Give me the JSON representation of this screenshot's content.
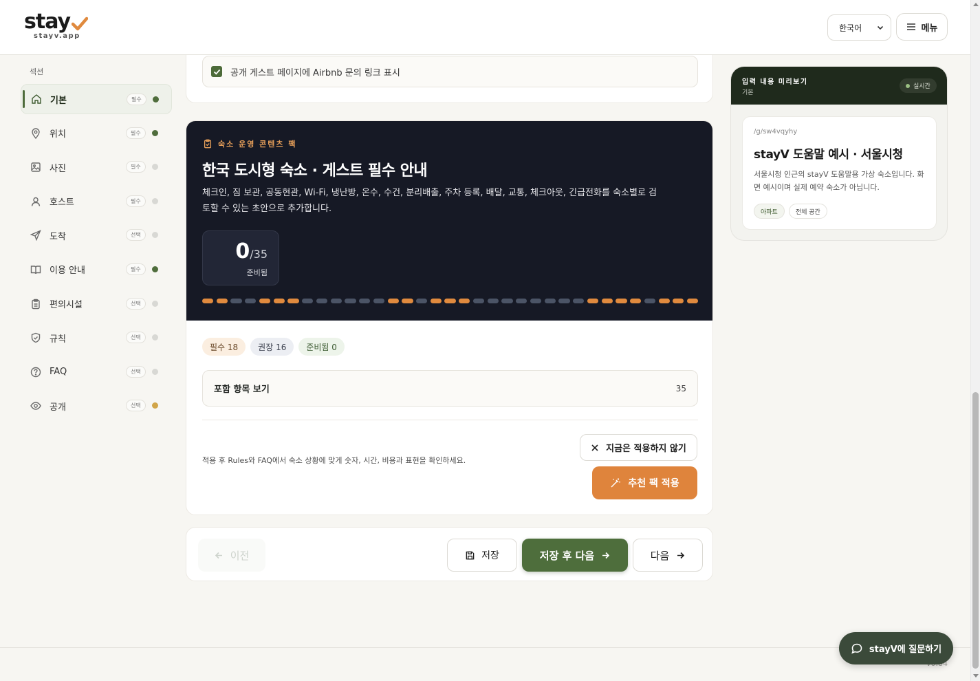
{
  "header": {
    "logo_text": "stay",
    "logo_sub": "stayv.app",
    "language": "한국어",
    "menu_label": "메뉴"
  },
  "sidebar": {
    "title": "섹션",
    "items": [
      {
        "label": "기본",
        "badge": "필수",
        "status": "complete",
        "icon": "home-icon"
      },
      {
        "label": "위치",
        "badge": "필수",
        "status": "complete",
        "icon": "map-pin-icon"
      },
      {
        "label": "사진",
        "badge": "필수",
        "status": "empty",
        "icon": "image-icon"
      },
      {
        "label": "호스트",
        "badge": "필수",
        "status": "empty",
        "icon": "user-icon"
      },
      {
        "label": "도착",
        "badge": "선택",
        "status": "empty",
        "icon": "send-icon"
      },
      {
        "label": "이용 안내",
        "badge": "필수",
        "status": "complete",
        "icon": "book-icon"
      },
      {
        "label": "편의시설",
        "badge": "선택",
        "status": "empty",
        "icon": "clipboard-icon"
      },
      {
        "label": "규칙",
        "badge": "선택",
        "status": "empty",
        "icon": "shield-icon"
      },
      {
        "label": "FAQ",
        "badge": "선택",
        "status": "empty",
        "icon": "help-circle-icon"
      },
      {
        "label": "공개",
        "badge": "선택",
        "status": "partial",
        "icon": "eye-icon"
      }
    ]
  },
  "basic": {
    "airbnb_link_label": "공개 게스트 페이지에 Airbnb 문의 링크 표시",
    "airbnb_link_checked": true
  },
  "pack": {
    "eyebrow": "숙소 운영 콘텐츠 팩",
    "title": "한국 도시형 숙소 · 게스트 필수 안내",
    "description": "체크인, 짐 보관, 공동현관, Wi-Fi, 냉난방, 온수, 수건, 분리배출, 주차 등록, 배달, 교통, 체크아웃, 긴급전화를 숙소별로 검토할 수 있는 초안으로 추가합니다.",
    "ready_count": "0",
    "total_count": "/35",
    "ready_label": "준비됨",
    "progress_pattern": [
      1,
      1,
      0,
      0,
      1,
      1,
      1,
      0,
      0,
      0,
      0,
      0,
      0,
      1,
      1,
      0,
      1,
      1,
      1,
      0,
      0,
      0,
      0,
      0,
      0,
      0,
      0,
      1,
      1,
      1,
      1,
      0,
      1,
      1,
      1
    ],
    "pill_required": "필수 18",
    "pill_recommended": "권장 16",
    "pill_ready": "준비됨 0",
    "included_label": "포함 항목 보기",
    "included_count": "35",
    "note": "적용 후 Rules와 FAQ에서 숙소 상황에 맞게 숫자, 시간, 비용과 표현을 확인하세요.",
    "skip_label": "지금은 적용하지 않기",
    "apply_label": "추천 팩 적용"
  },
  "nav": {
    "prev_label": "이전",
    "save_label": "저장",
    "save_next_label": "저장 후 다음",
    "next_label": "다음"
  },
  "preview": {
    "title": "입력 내용 미리보기",
    "subtitle": "기본",
    "live_label": "실시간",
    "slug": "/g/sw4vqyhy",
    "name": "stayV 도움말 예시 · 서울시청",
    "description": "서울시청 인근의 stayV 도움말용 가상 숙소입니다. 화면 예시이며 실제 예약 숙소가 아닙니다.",
    "tags": [
      "아파트",
      "전체 공간"
    ]
  },
  "footer": {
    "version": "v0.84",
    "chat_label": "stayV에 질문하기"
  },
  "colors": {
    "brand_green": "#4e6e3c",
    "brand_orange": "#df843c",
    "hero_dark": "#161925"
  }
}
